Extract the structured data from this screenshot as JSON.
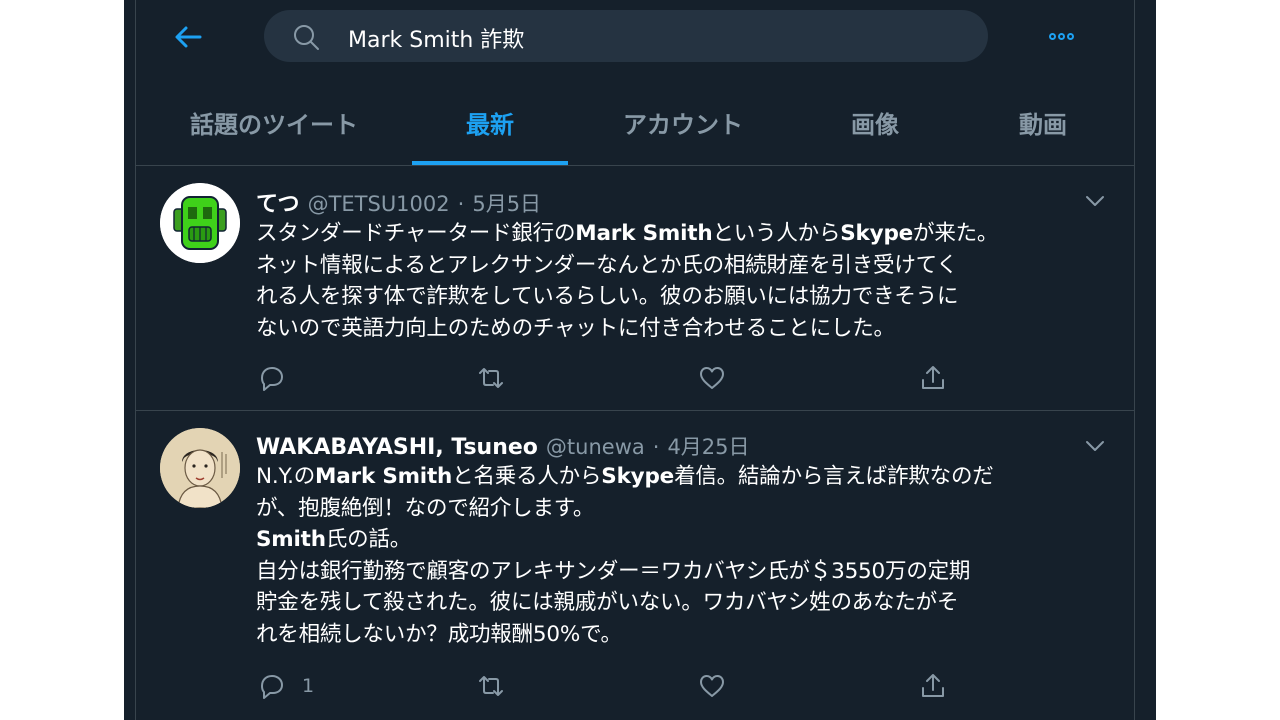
{
  "search": {
    "query": "Mark Smith 詐欺"
  },
  "tabs": [
    {
      "label": "話題のツイート",
      "active": false
    },
    {
      "label": "最新",
      "active": true
    },
    {
      "label": "アカウント",
      "active": false
    },
    {
      "label": "画像",
      "active": false
    },
    {
      "label": "動画",
      "active": false
    }
  ],
  "tweets": [
    {
      "name": "てつ",
      "handle": "@TETSU1002",
      "dot": "·",
      "date": "5月5日",
      "lines": [
        [
          "スタンダードチャータード銀行の",
          "Mark Smith",
          "という人から",
          "Skype",
          "が来た。"
        ],
        [
          "ネット情報によるとアレクサンダーなんとか氏の相続財産を引き受けてく"
        ],
        [
          "れる人を探す体で詐欺をしているらしい。彼のお願いには協力できそうに"
        ],
        [
          "ないので英語力向上のためのチャットに付き合わせることにした。"
        ]
      ],
      "reply_count": ""
    },
    {
      "name": "WAKABAYASHI, Tsuneo",
      "handle": "@tunewa",
      "dot": "·",
      "date": "4月25日",
      "lines": [
        [
          "N.Y.の",
          "Mark Smith",
          "と名乗る人から",
          "Skype",
          "着信。結論から言えば詐欺なのだ"
        ],
        [
          "が、抱腹絶倒！なので紹介します。"
        ],
        [
          "",
          "Smith",
          "氏の話。"
        ],
        [
          "自分は銀行勤務で顧客のアレキサンダー＝ワカバヤシ氏が＄3550万の定期"
        ],
        [
          "貯金を残して殺された。彼には親戚がいない。ワカバヤシ姓のあなたがそ"
        ],
        [
          "れを相続しないか？成功報酬50%で。"
        ]
      ],
      "reply_count": "1"
    }
  ],
  "colors": {
    "background": "#15202b",
    "accent": "#1da1f2",
    "secondary_text": "#8899a6",
    "border": "#38444d"
  }
}
